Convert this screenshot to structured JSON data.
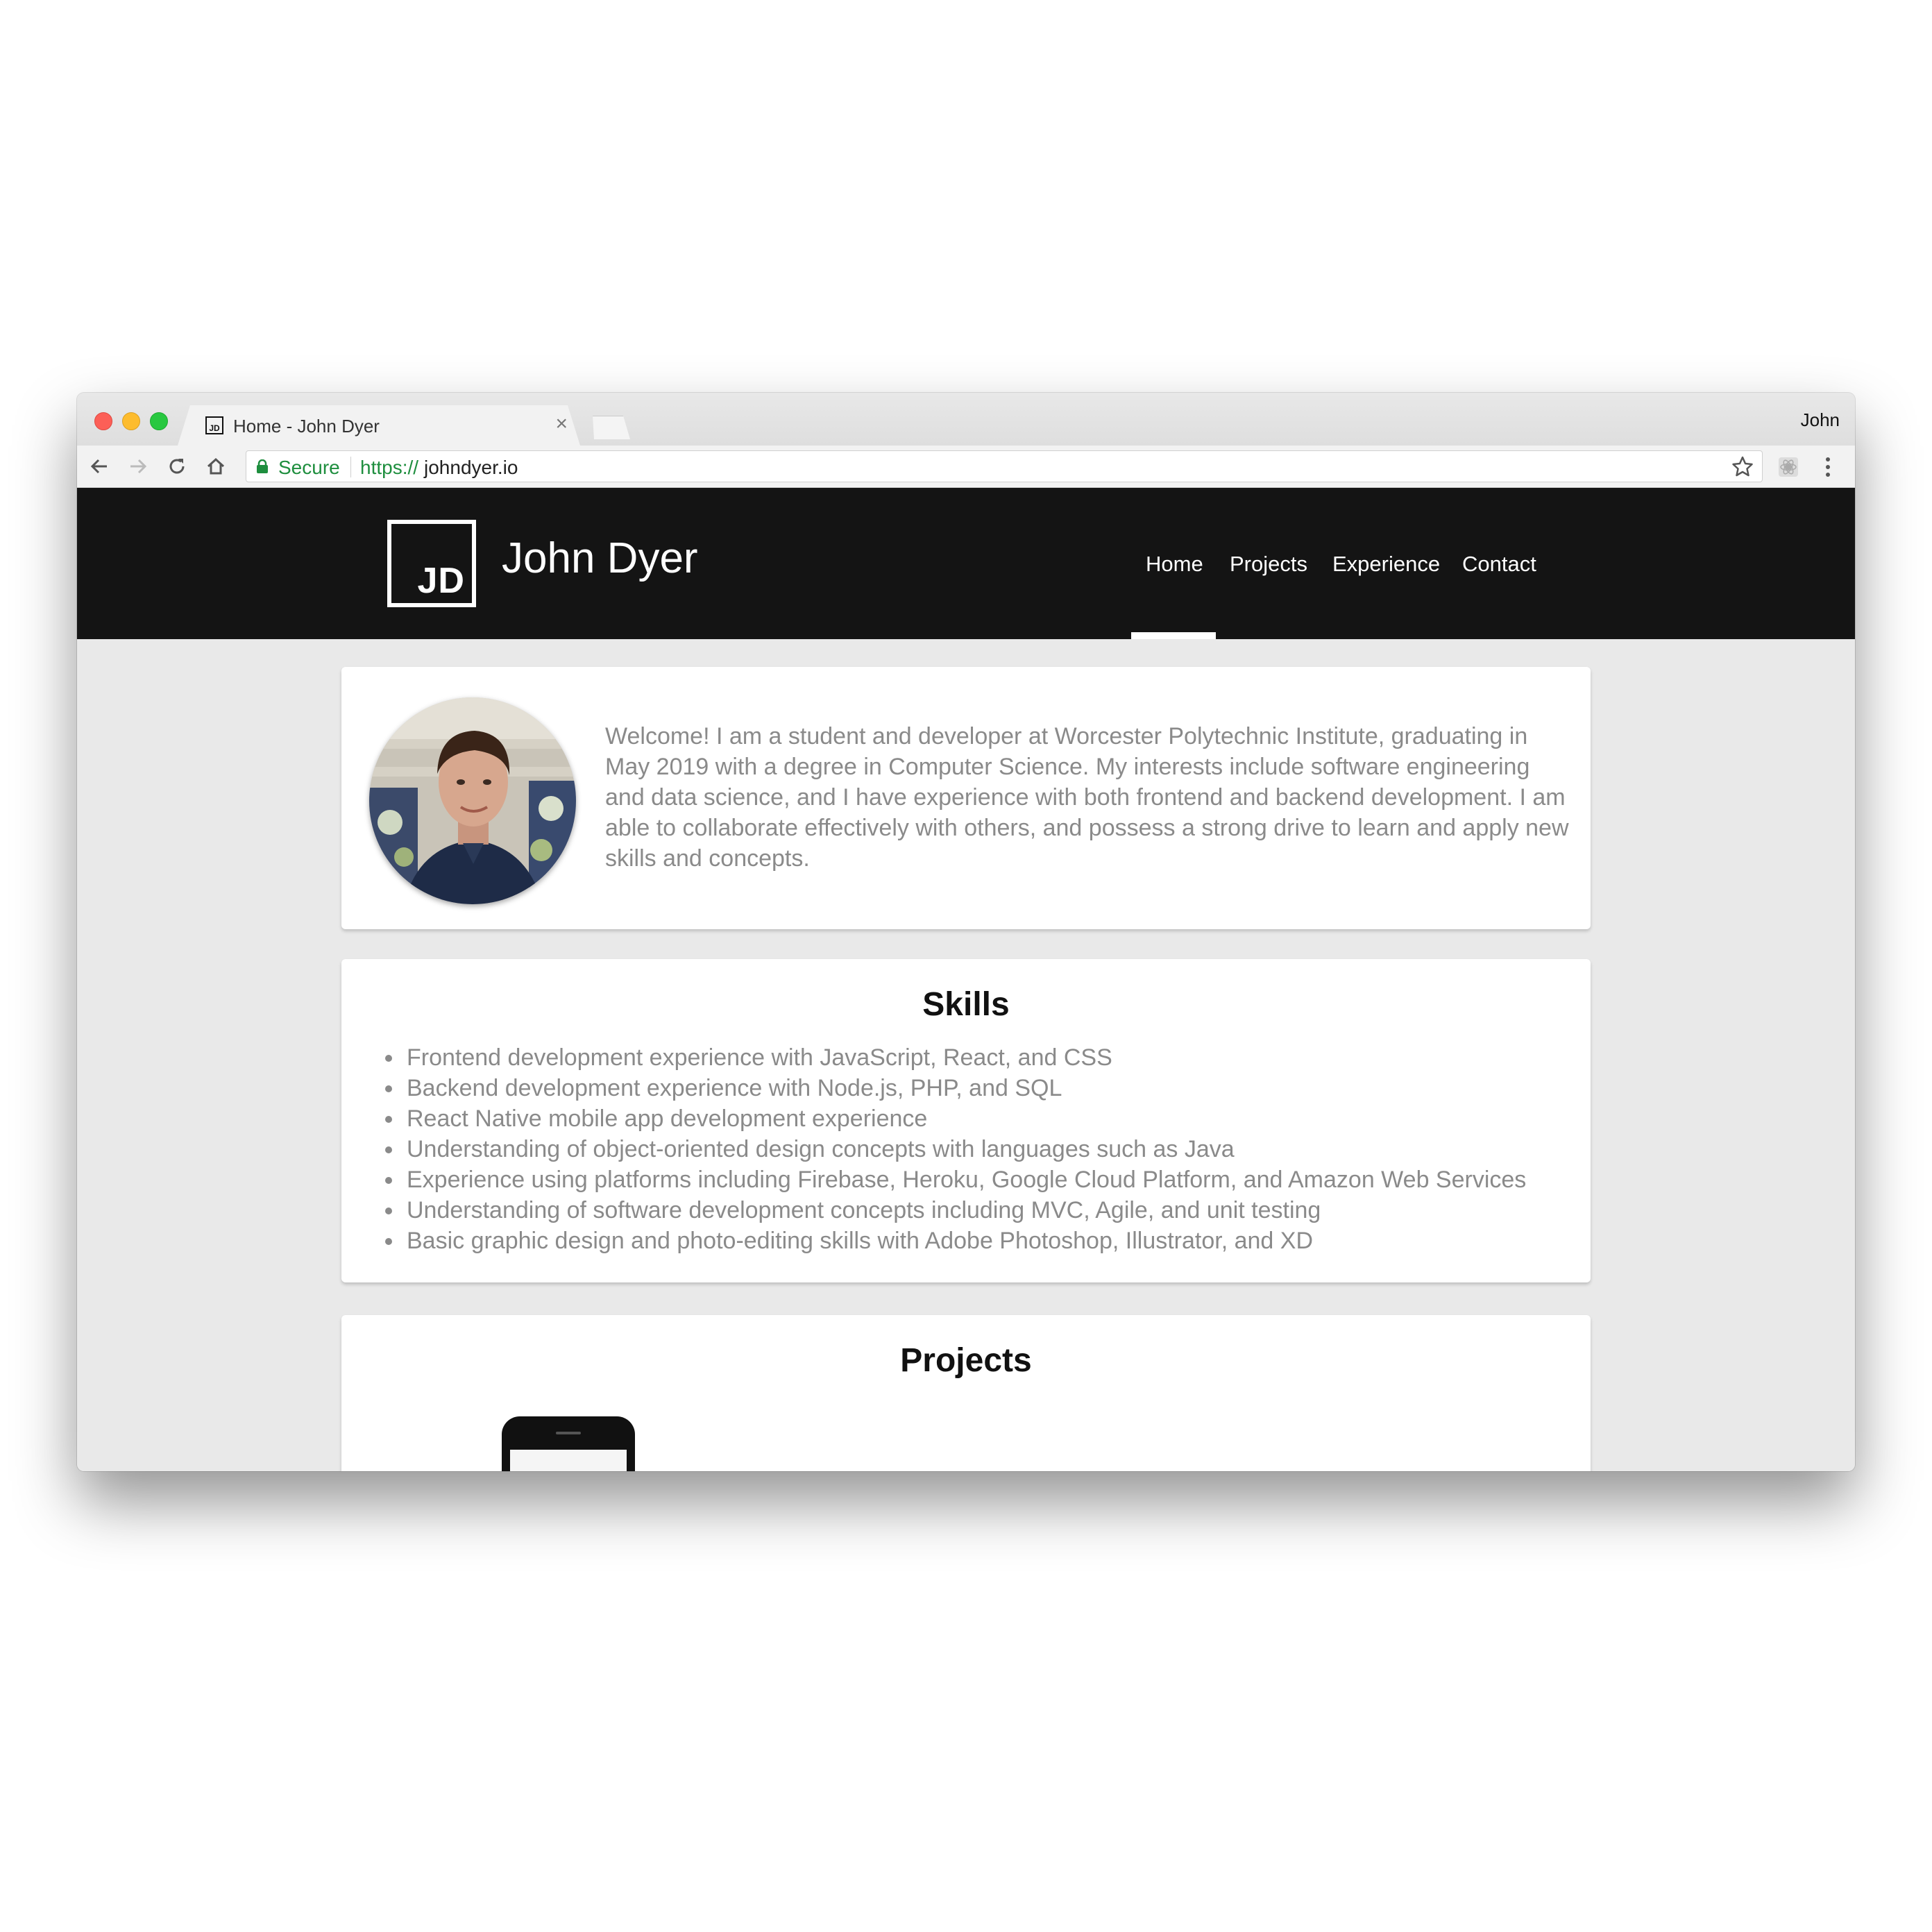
{
  "browser": {
    "tab": {
      "title": "Home - John Dyer",
      "favicon_text": "JD",
      "close_glyph": "×"
    },
    "profile_name": "John",
    "address_bar": {
      "secure_label": "Secure",
      "url_scheme": "https://",
      "url_host": "johndyer.io"
    },
    "icons": [
      "back-arrow-icon",
      "forward-arrow-icon",
      "reload-icon",
      "home-icon",
      "lock-icon",
      "star-icon",
      "extension-icon",
      "menu-dots-icon"
    ]
  },
  "site": {
    "logo_text": "JD",
    "name": "John Dyer",
    "nav": [
      {
        "label": "Home",
        "active": true
      },
      {
        "label": "Projects",
        "active": false
      },
      {
        "label": "Experience",
        "active": false
      },
      {
        "label": "Contact",
        "active": false
      }
    ]
  },
  "intro": {
    "text": "Welcome! I am a student and developer at Worcester Polytechnic Institute, graduating in May 2019 with a degree in Computer Science. My interests include software engineering and data science, and I have experience with both frontend and backend development. I am able to collaborate effectively with others, and possess a strong drive to learn and apply new skills and concepts."
  },
  "skills": {
    "heading": "Skills",
    "items": [
      "Frontend development experience with JavaScript, React, and CSS",
      "Backend development experience with Node.js, PHP, and SQL",
      "React Native mobile app development experience",
      "Understanding of object-oriented design concepts with languages such as Java",
      "Experience using platforms including Firebase, Heroku, Google Cloud Platform, and Amazon Web Services",
      "Understanding of software development concepts including MVC, Agile, and unit testing",
      "Basic graphic design and photo-editing skills with Adobe Photoshop, Illustrator, and XD"
    ]
  },
  "projects": {
    "heading": "Projects"
  },
  "colors": {
    "header_bg": "#141414",
    "page_bg": "#e9e9e9",
    "body_text": "#8a8a8a",
    "secure_green": "#1e8e3e"
  }
}
